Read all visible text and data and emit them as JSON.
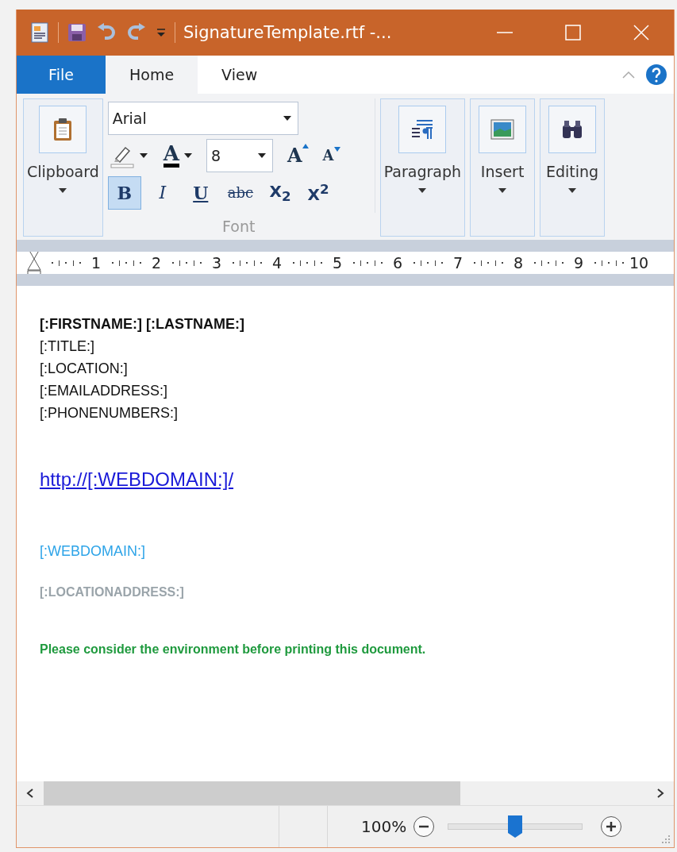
{
  "window": {
    "title": "SignatureTemplate.rtf -..."
  },
  "ribbon_tabs": [
    {
      "label": "File",
      "kind": "file",
      "selected": false
    },
    {
      "label": "Home",
      "kind": "tab",
      "selected": true
    },
    {
      "label": "View",
      "kind": "tab",
      "selected": false
    }
  ],
  "clipboard": {
    "label": "Clipboard"
  },
  "font": {
    "label": "Font",
    "name": "Arial",
    "size": "8",
    "color_label": "A",
    "grow_label": "A",
    "shrink_label": "A",
    "formats": [
      {
        "label": "B",
        "kind": "bold",
        "selected": true
      },
      {
        "label": "I",
        "kind": "italic",
        "selected": false
      },
      {
        "label": "U",
        "kind": "underline",
        "selected": false
      },
      {
        "label": "abc",
        "kind": "strike",
        "selected": false
      },
      {
        "label": "X$_{2}$",
        "kind": "sub",
        "selected": false
      },
      {
        "label": "X$^{2}$",
        "kind": "sup",
        "selected": false
      }
    ]
  },
  "groups": [
    {
      "label": "Paragraph",
      "kind": "paragraph"
    },
    {
      "label": "Insert",
      "kind": "insert"
    },
    {
      "label": "Editing",
      "kind": "editing"
    }
  ],
  "ruler": {
    "numbers": [
      "1",
      "2",
      "3",
      "4",
      "5",
      "6",
      "7",
      "8",
      "9",
      "10"
    ]
  },
  "document": {
    "lines": [
      {
        "text": "[:FIRSTNAME:]  [:LASTNAME:]",
        "kind": "bold"
      },
      {
        "text": "[:TITLE:]",
        "kind": "plain"
      },
      {
        "text": "[:LOCATION:]",
        "kind": "plain"
      },
      {
        "text": "[:EMAILADDRESS:]",
        "kind": "plain"
      },
      {
        "text": "[:PHONENUMBERS:]",
        "kind": "plain"
      },
      {
        "text": "http://[:WEBDOMAIN:]/",
        "kind": "link"
      },
      {
        "text": "[:WEBDOMAIN:]",
        "kind": "accent"
      },
      {
        "text": "[:LOCATIONADDRESS:]",
        "kind": "muted"
      },
      {
        "text": "Please consider the environment before printing this document.",
        "kind": "note"
      }
    ]
  },
  "status_bar": {
    "zoom": "100%",
    "zoom_slider": {
      "level": 0.5
    }
  }
}
